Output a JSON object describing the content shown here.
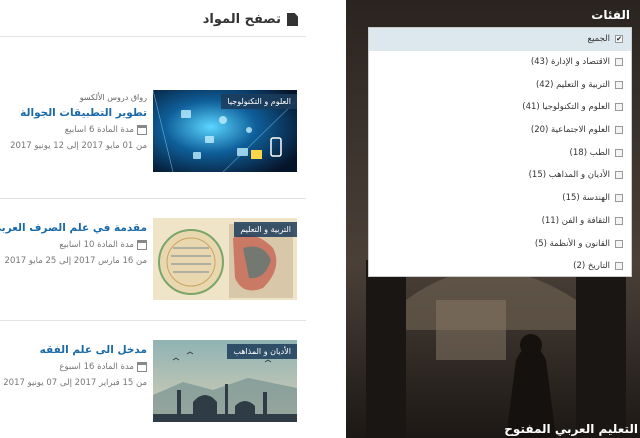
{
  "main": {
    "title": "تصفح المواد",
    "courses": [
      {
        "category": "العلوم و التكنولوجيا",
        "provider": "رواق دروس الألكسو",
        "title": "تطوير التطبيقات الجوالة",
        "duration": "مدة المادة 6 اسابيع",
        "dates": "من 01 مايو 2017 إلى 12 يونيو 2017"
      },
      {
        "category": "التربية و التعليم",
        "provider": "",
        "title": "مقدمة في علم الصرف العربي",
        "duration": "مدة المادة 10 اسابيع",
        "dates": "من 16 مارس 2017 إلى 25 مايو 2017"
      },
      {
        "category": "الأديان و المذاهب",
        "provider": "",
        "title": "مدخل الى علم الفقه",
        "duration": "مدة المادة 16 اسبوع",
        "dates": "من 15 فبراير 2017 إلى 07 يونيو 2017"
      }
    ]
  },
  "sidebar": {
    "heading": "الفئات",
    "categories": [
      {
        "label": "الجميع",
        "checked": true
      },
      {
        "label": "الاقتصاد و الإدارة (43)",
        "checked": false
      },
      {
        "label": "التربية و التعليم (42)",
        "checked": false
      },
      {
        "label": "العلوم و التكنولوجيا (41)",
        "checked": false
      },
      {
        "label": "العلوم الاجتماعية (20)",
        "checked": false
      },
      {
        "label": "الطب (18)",
        "checked": false
      },
      {
        "label": "الأديان و المذاهب (15)",
        "checked": false
      },
      {
        "label": "الهندسة (15)",
        "checked": false
      },
      {
        "label": "الثقافة و الفن (11)",
        "checked": false
      },
      {
        "label": "القانون و الأنظمة (5)",
        "checked": false
      },
      {
        "label": "التاريخ (2)",
        "checked": false
      }
    ],
    "footer_title": "التعليم العربي المفتوح"
  },
  "icons": {
    "title_icon": "document-icon",
    "duration_icon": "calendar-icon"
  },
  "colors": {
    "link": "#1a6aa8",
    "badge": "#1c3c5a",
    "selected": "#dde8ee"
  }
}
